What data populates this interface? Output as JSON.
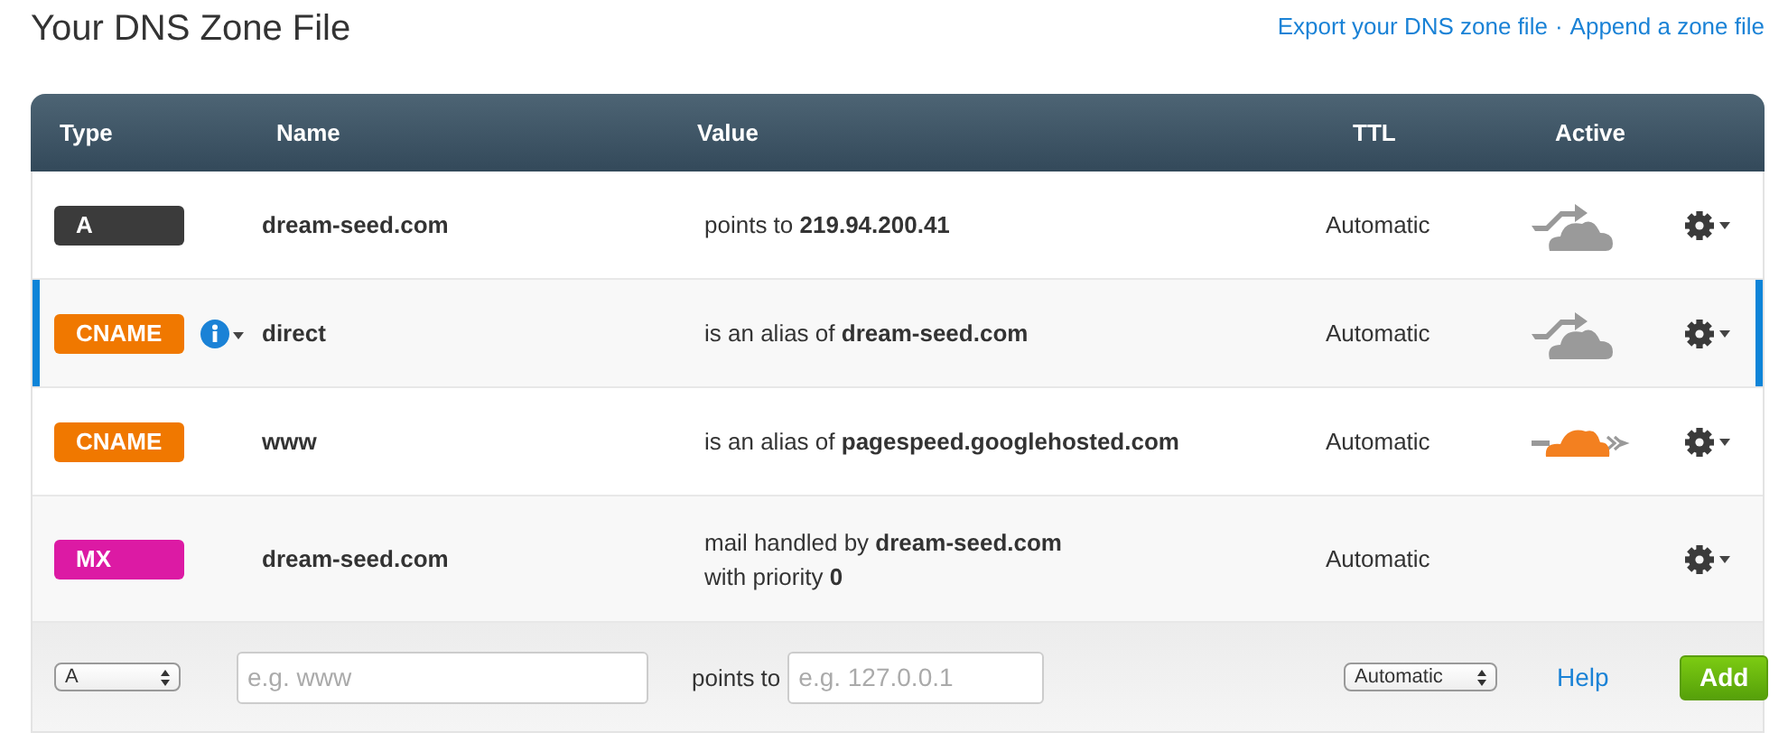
{
  "title": "Your DNS Zone File",
  "links": [
    {
      "label": "Export your DNS zone file"
    },
    {
      "label": "Append a zone file"
    }
  ],
  "link_separator": "·",
  "table": {
    "columns": [
      "Type",
      "Name",
      "Value",
      "TTL",
      "Active"
    ],
    "rows": [
      {
        "type": "A",
        "color": "#3b3b3b",
        "selected": false,
        "info": false,
        "name": "dream-seed.com",
        "value": [
          "points to **219.94.200.41**"
        ],
        "ttl": "Automatic",
        "proxied": false
      },
      {
        "type": "CNAME",
        "color": "#f07800",
        "selected": true,
        "info": true,
        "name": "direct",
        "value": [
          "is an alias of **dream-seed.com**"
        ],
        "ttl": "Automatic",
        "proxied": false
      },
      {
        "type": "CNAME",
        "color": "#f07800",
        "selected": false,
        "info": false,
        "name": "www",
        "value": [
          "is an alias of **pagespeed.googlehosted.com**"
        ],
        "ttl": "Automatic",
        "proxied": true
      },
      {
        "type": "MX",
        "color": "#dc1aa4",
        "selected": false,
        "info": false,
        "name": "dream-seed.com",
        "value": [
          "mail handled by **dream-seed.com**",
          "with priority **0**"
        ],
        "ttl": "Automatic"
      }
    ]
  },
  "new_record": {
    "type_select": "A",
    "name_placeholder": "e.g. www",
    "value_label": "points to",
    "value_placeholder": "e.g. 127.0.0.1",
    "ttl_select": "Automatic",
    "help_link": "Help",
    "add_button": "Add"
  }
}
